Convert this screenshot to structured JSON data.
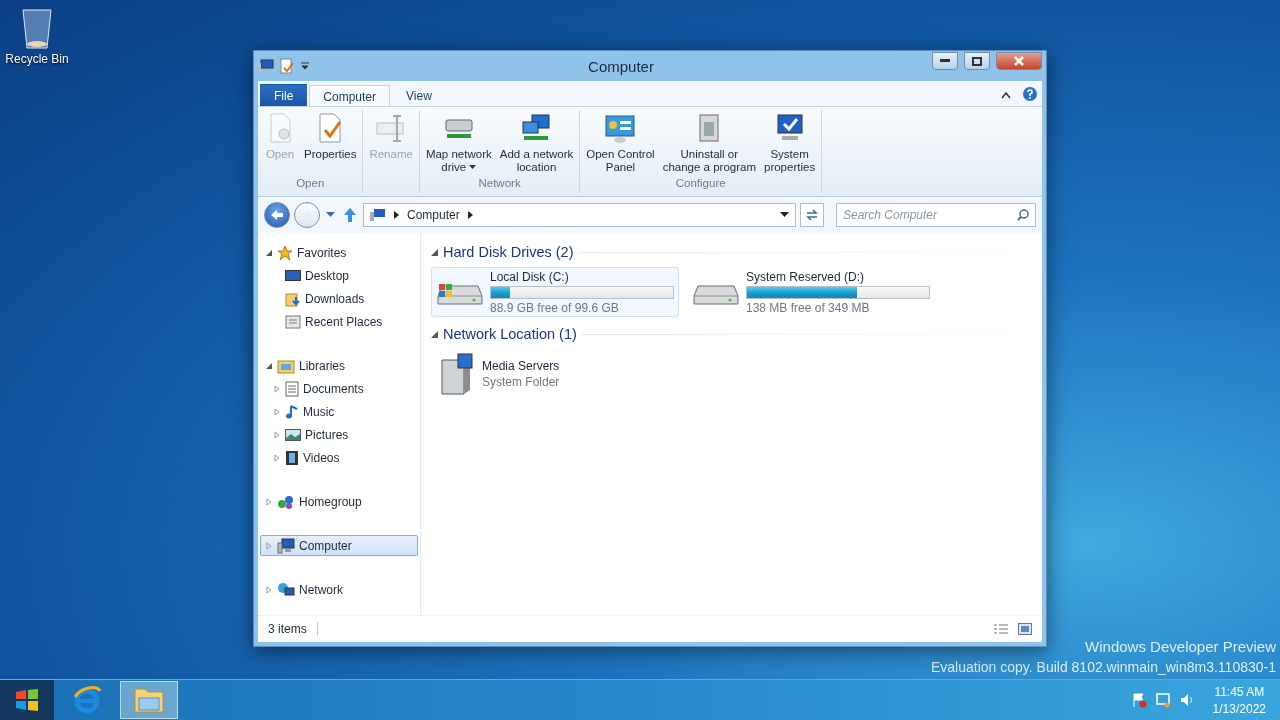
{
  "desktop_icons": [
    {
      "label": "Recycle Bin"
    }
  ],
  "window": {
    "title": "Computer"
  },
  "ribbon": {
    "tabs": [
      {
        "label": "File",
        "kind": "file",
        "selected": false
      },
      {
        "label": "Computer",
        "kind": "tab",
        "selected": true
      },
      {
        "label": "View",
        "kind": "tab",
        "selected": false
      }
    ],
    "groups": [
      {
        "label": "Open",
        "buttons": [
          {
            "lines": [
              "Open"
            ],
            "disabled": true,
            "menu": false
          },
          {
            "lines": [
              "Properties"
            ],
            "disabled": false,
            "menu": false
          }
        ]
      },
      {
        "buttons": [
          {
            "lines": [
              "Rename"
            ],
            "disabled": true,
            "menu": false
          }
        ]
      },
      {
        "label": "Network",
        "buttons": [
          {
            "lines": [
              "Map network",
              "drive"
            ],
            "disabled": false,
            "menu": true
          },
          {
            "lines": [
              "Add a network",
              "location"
            ],
            "disabled": false,
            "menu": false
          }
        ]
      },
      {
        "label": "Configure",
        "buttons": [
          {
            "lines": [
              "Open Control",
              "Panel"
            ],
            "disabled": false,
            "menu": false
          },
          {
            "lines": [
              "Uninstall or",
              "change a program"
            ],
            "disabled": false,
            "menu": false
          },
          {
            "lines": [
              "System",
              "properties"
            ],
            "disabled": false,
            "menu": false
          }
        ]
      }
    ]
  },
  "address": {
    "breadcrumbs": [
      "Computer"
    ]
  },
  "search": {
    "placeholder": "Search Computer"
  },
  "navigation": [
    {
      "label": "Favorites",
      "kind": "favorites",
      "expanded": true,
      "selected": false,
      "children": [
        {
          "label": "Desktop",
          "kind": "desktop",
          "selected": false
        },
        {
          "label": "Downloads",
          "kind": "downloads",
          "selected": false
        },
        {
          "label": "Recent Places",
          "kind": "recent",
          "selected": false
        }
      ]
    },
    {
      "label": "Libraries",
      "kind": "library",
      "expanded": true,
      "selected": false,
      "children": [
        {
          "label": "Documents",
          "kind": "documents",
          "expanded": false,
          "selected": false
        },
        {
          "label": "Music",
          "kind": "music",
          "expanded": false,
          "selected": false
        },
        {
          "label": "Pictures",
          "kind": "pictures",
          "expanded": false,
          "selected": false
        },
        {
          "label": "Videos",
          "kind": "videos",
          "expanded": false,
          "selected": false
        }
      ]
    },
    {
      "label": "Homegroup",
      "kind": "homegroup",
      "expanded": false,
      "selected": false
    },
    {
      "label": "Computer",
      "kind": "computer",
      "expanded": false,
      "selected": true
    },
    {
      "label": "Network",
      "kind": "network",
      "expanded": false,
      "selected": false
    }
  ],
  "content": {
    "groups": [
      {
        "title": "Hard Disk Drives (2)",
        "expanded": true,
        "items": [
          {
            "kind": "system_drive",
            "name": "Local Disk (C:)",
            "level": 0.107,
            "detail": "88.9 GB free of 99.6 GB",
            "selected": true
          },
          {
            "kind": "drive",
            "name": "System Reserved (D:)",
            "level": 0.605,
            "detail": "138 MB free of 349 MB",
            "selected": false
          }
        ]
      },
      {
        "title": "Network Location (1)",
        "expanded": true,
        "items": [
          {
            "kind": "folder",
            "name": "Media Servers",
            "detail": "System Folder",
            "selected": false
          }
        ]
      }
    ]
  },
  "status_bar": {
    "text": "3 items"
  },
  "desktop_text": [
    "Windows Developer Preview",
    "Evaluation copy. Build 8102.winmain_win8m3.110830-1"
  ],
  "taskbar": {
    "apps": [
      {
        "kind": "ie",
        "active": false
      },
      {
        "kind": "explorer",
        "active": true
      }
    ],
    "time": "11:45 AM",
    "date": "1/13/2022"
  }
}
